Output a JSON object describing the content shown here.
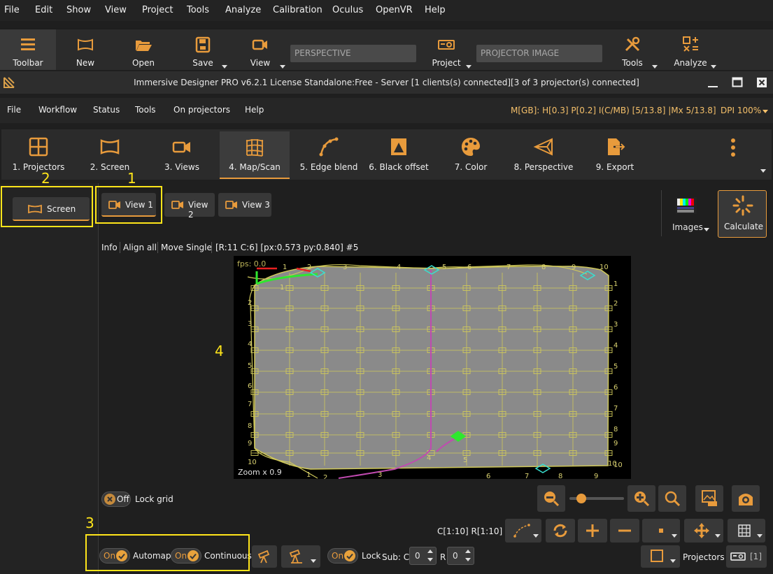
{
  "menu": [
    "File",
    "Edit",
    "Show",
    "View",
    "Project",
    "Tools",
    "Analyze",
    "Calibration",
    "Oculus",
    "OpenVR",
    "Help"
  ],
  "toolbar": {
    "toolbar": "Toolbar",
    "new": "New",
    "open": "Open",
    "save": "Save",
    "view": "View",
    "perspective_field": "PERSPECTIVE",
    "project": "Project",
    "projector_image_field": "PROJECTOR IMAGE",
    "tools": "Tools",
    "analyze": "Analyze"
  },
  "window": {
    "title": "Immersive Designer PRO v6.2.1 License Standalone:Free - Server [1 clients(s) connected][3 of 3 projector(s) connected]"
  },
  "menu2": [
    "File",
    "Workflow",
    "Status",
    "Tools",
    "On projectors",
    "Help"
  ],
  "status_text": "M[GB]: H[0.3] P[0.2] I(C/MB) [5/13.8] |Mx 5/13.8]",
  "dpi": "DPI 100%",
  "steps": [
    "1. Projectors",
    "2. Screen",
    "3. Views",
    "4. Map/Scan",
    "5. Edge blend",
    "6. Black offset",
    "7. Color",
    "8. Perspective",
    "9. Export"
  ],
  "left": {
    "screen_button": "Screen"
  },
  "views": [
    "View 1",
    "View 2",
    "View 3"
  ],
  "right": {
    "images": "Images",
    "calculate": "Calculate"
  },
  "info": {
    "info": "Info",
    "align_all": "Align all",
    "move_single": "Move Single",
    "readout": "[R:11 C:6] [px:0.573 py:0.840] #5"
  },
  "grid": {
    "fps": "fps: 0.0",
    "zoom": "Zoom x 0.9",
    "top_labels": [
      "1",
      "2",
      "3",
      "4",
      "5",
      "6",
      "7",
      "8",
      "9",
      "10"
    ],
    "left_labels": [
      "1",
      "2",
      "3",
      "4",
      "5",
      "6",
      "7",
      "8",
      "9",
      "10"
    ],
    "right_labels": [
      "1",
      "2",
      "3",
      "4",
      "5",
      "6",
      "7",
      "8",
      "9",
      "10"
    ],
    "bottom_labels": [
      "1",
      "2",
      "3",
      "4",
      "5",
      "6",
      "7",
      "8",
      "9",
      "10"
    ]
  },
  "annotations": [
    "1",
    "2",
    "3",
    "4"
  ],
  "controls": {
    "off": "Off",
    "lock_grid": "Lock grid",
    "range": "C[1:10] R[1:10]",
    "on": "On",
    "automap": "Automap",
    "continuous": "Continuous",
    "lock": "Lock",
    "sub_c": "Sub: C",
    "sub_c_val": "0",
    "r": "R",
    "r_val": "0",
    "projectors": "Projectors",
    "projector_count": "[1]"
  },
  "colors": {
    "accent": "#e89b3c",
    "annotation": "#ffe51a",
    "grid_line": "#cfc85a",
    "grid_fill": "#8a8a8a"
  }
}
